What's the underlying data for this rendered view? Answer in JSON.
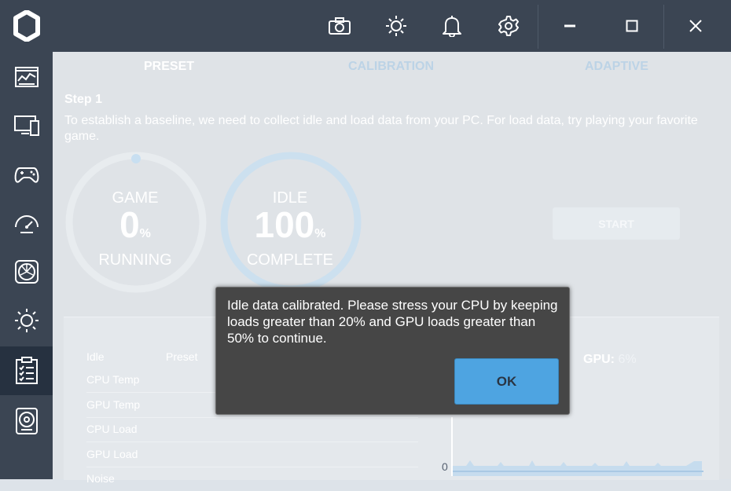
{
  "app": {
    "top_icons": [
      "camera-icon",
      "brightness-icon",
      "bell-icon",
      "gear-icon"
    ],
    "window_controls": [
      "minimize-icon",
      "maximize-icon",
      "close-icon"
    ]
  },
  "sidebar": {
    "items": [
      {
        "icon": "dashboard-chart-icon"
      },
      {
        "icon": "monitor-icon"
      },
      {
        "icon": "gamepad-icon"
      },
      {
        "icon": "gauge-icon"
      },
      {
        "icon": "fan-icon"
      },
      {
        "icon": "brightness-icon"
      },
      {
        "icon": "clipboard-checklist-icon",
        "active": true
      },
      {
        "icon": "hard-drive-icon"
      }
    ]
  },
  "tabs": [
    {
      "label": "PRESET",
      "active": true
    },
    {
      "label": "CALIBRATION",
      "active": false
    },
    {
      "label": "ADAPTIVE",
      "active": false
    }
  ],
  "step": {
    "title": "Step 1",
    "description": "To establish a baseline, we need to collect idle and load data from your PC. For load data, try playing your favorite game."
  },
  "rings": [
    {
      "top": "GAME",
      "value": "0",
      "unit": "%",
      "bottom": "RUNNING",
      "progress": 0
    },
    {
      "top": "IDLE",
      "value": "100",
      "unit": "%",
      "bottom": "COMPLETE",
      "progress": 1.0
    }
  ],
  "start_label": "START",
  "table": {
    "headers": [
      "Idle",
      "Preset"
    ],
    "rows": [
      "CPU Temp",
      "GPU Temp",
      "CPU Load",
      "GPU Load",
      "Noise"
    ]
  },
  "gpu": {
    "label": "GPU:",
    "value": "6%"
  },
  "graph": {
    "zero_label": "0"
  },
  "dialog": {
    "message": "Idle data calibrated. Please stress your CPU by keeping loads greater than 20% and GPU loads greater than 50% to continue.",
    "ok_label": "OK"
  },
  "colors": {
    "accent": "#4ea4e1",
    "sidebar": "#3b4553",
    "dialog": "#464646"
  }
}
